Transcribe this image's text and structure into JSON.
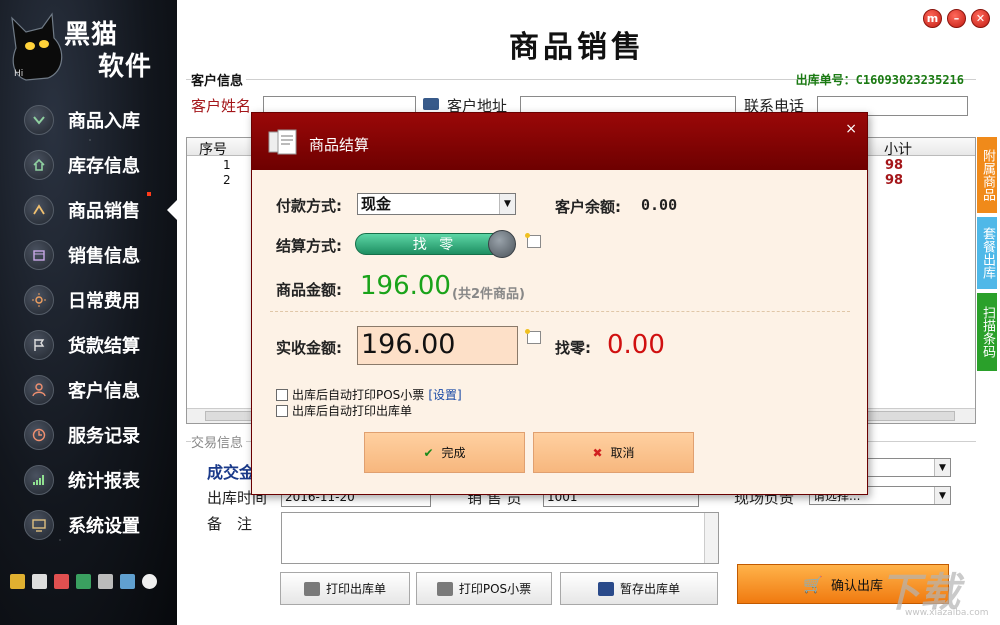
{
  "sidebar": {
    "logo_line1": "黑猫",
    "logo_line2": "软件",
    "logo_hi": "Hi",
    "items": [
      {
        "label": "商品入库",
        "icon": "chevron-down-icon"
      },
      {
        "label": "库存信息",
        "icon": "home-icon"
      },
      {
        "label": "商品销售",
        "icon": "chevron-up-icon"
      },
      {
        "label": "销售信息",
        "icon": "calendar-icon"
      },
      {
        "label": "日常费用",
        "icon": "sun-icon"
      },
      {
        "label": "货款结算",
        "icon": "flag-icon"
      },
      {
        "label": "客户信息",
        "icon": "user-icon"
      },
      {
        "label": "服务记录",
        "icon": "clock-icon"
      },
      {
        "label": "统计报表",
        "icon": "bar-chart-icon"
      },
      {
        "label": "系统设置",
        "icon": "monitor-icon"
      }
    ],
    "active_index": 2
  },
  "window_buttons": {
    "menu": "m",
    "minimize": "–",
    "close": "✕"
  },
  "page": {
    "title": "商品销售"
  },
  "customer": {
    "section_label": "客户信息",
    "order_no_label": "出库单号：",
    "order_no": "C16093023235216",
    "name_label": "客户姓名",
    "address_label": "客户地址",
    "phone_label": "联系电话"
  },
  "grid": {
    "col_seq": "序号",
    "col_subtotal": "小计",
    "rows": [
      {
        "seq": "1",
        "subtotal": "98"
      },
      {
        "seq": "2",
        "subtotal": "98"
      }
    ]
  },
  "side_tabs": [
    {
      "label": "附属商品",
      "color": "#f08a1a"
    },
    {
      "label": "套餐出库",
      "color": "#4fb8e8"
    },
    {
      "label": "扫描条码",
      "color": "#2aa02a"
    }
  ],
  "trade": {
    "section_label": "交易信息",
    "deal_label": "成交金",
    "outdate_label": "出库时间",
    "outdate_value": "2016-11-20",
    "salesman_label": "销 售 员",
    "salesman_value": "1001",
    "person_label": "现场负责",
    "person_value": "请选择...",
    "remarks_label": "备　注"
  },
  "buttons": {
    "print_out": "打印出库单",
    "print_pos": "打印POS小票",
    "save_draft": "暂存出库单",
    "confirm": "确认出库"
  },
  "dialog": {
    "title": "商品结算",
    "close": "×",
    "pay_method_label": "付款方式:",
    "pay_method_value": "现金",
    "balance_label": "客户余额:",
    "balance_value": "0.00",
    "settle_label": "结算方式:",
    "settle_value": "找 零",
    "goods_amount_label": "商品金额:",
    "goods_amount_value": "196.00",
    "goods_count_note": "(共2件商品)",
    "received_label": "实收金额:",
    "received_value": "196.00",
    "change_label": "找零:",
    "change_value": "0.00",
    "auto_print_pos": "出库后自动打印POS小票",
    "settings_link": "[设置]",
    "auto_print_out": "出库后自动打印出库单",
    "done": "完成",
    "cancel": "取消"
  },
  "watermark": {
    "text": "下载吧",
    "sub": "www.xiazaiba.com"
  },
  "colors": {
    "accent_red": "#8a0000",
    "amount_green": "#1aa31a",
    "change_red": "#d01010",
    "confirm_orange": "#f07a10"
  }
}
